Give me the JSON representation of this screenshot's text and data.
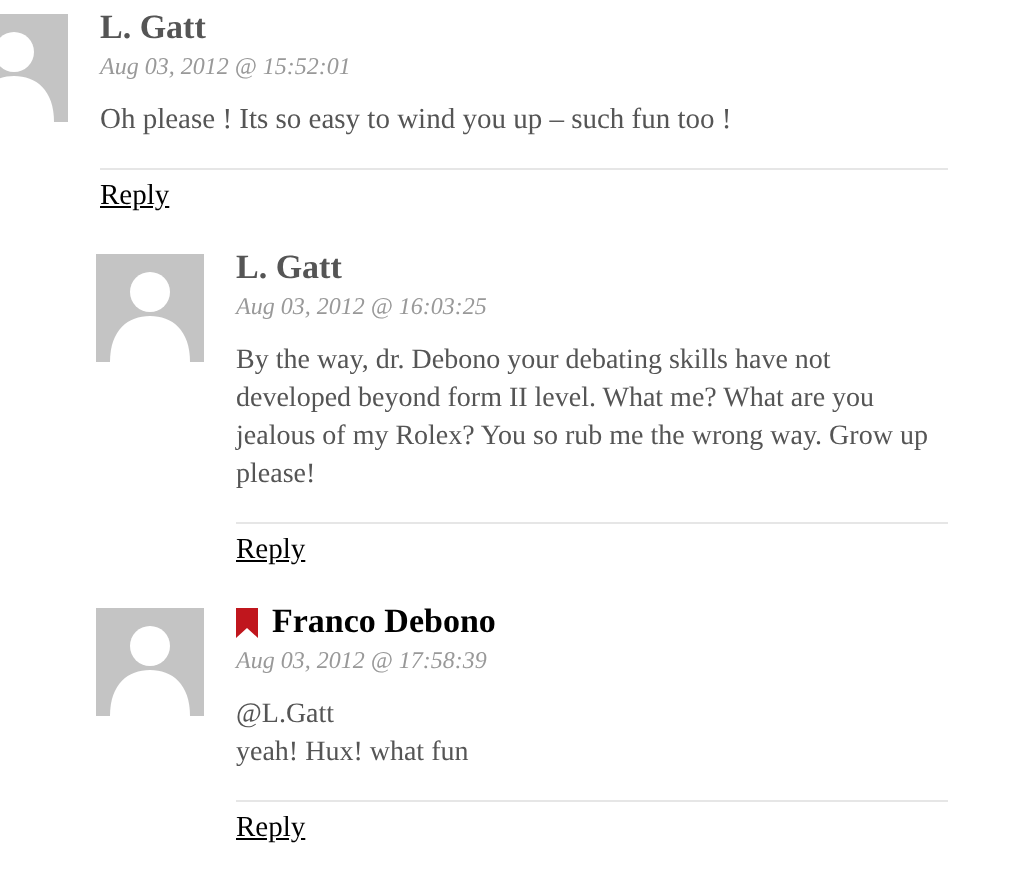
{
  "comments": [
    {
      "author": "L. Gatt",
      "is_author": false,
      "date": "Aug 03, 2012 @ 15:52:01",
      "body": [
        "Oh please ! Its so easy to wind you up – such fun too !"
      ],
      "reply": "Reply",
      "children": [
        {
          "author": "L. Gatt",
          "is_author": false,
          "date": "Aug 03, 2012 @ 16:03:25",
          "body": [
            "By the way, dr. Debono your debating skills have not developed beyond form II level. What me? What are you jealous of my Rolex? You so rub me the wrong way. Grow up please!"
          ],
          "reply": "Reply"
        },
        {
          "author": "Franco Debono",
          "is_author": true,
          "date": "Aug 03, 2012 @ 17:58:39",
          "body": [
            "@L.Gatt",
            "yeah! Hux! what fun"
          ],
          "reply": "Reply"
        }
      ]
    }
  ]
}
